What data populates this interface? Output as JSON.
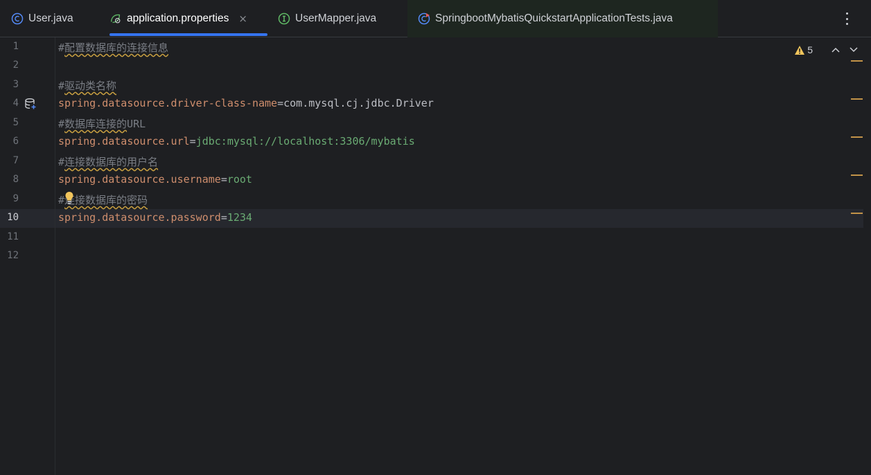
{
  "tabs": [
    {
      "label": "User.java",
      "icon": "class-c-icon",
      "active": false
    },
    {
      "label": "application.properties",
      "icon": "spring-leaf-icon",
      "active": true,
      "close": "×"
    },
    {
      "label": "UserMapper.java",
      "icon": "interface-i-icon",
      "active": false
    },
    {
      "label": "SpringbootMybatisQuickstartApplicationTests.java",
      "icon": "test-class-icon",
      "active": false
    }
  ],
  "inspection": {
    "warnings": "5"
  },
  "lines": [
    {
      "n": "1"
    },
    {
      "n": "2"
    },
    {
      "n": "3"
    },
    {
      "n": "4"
    },
    {
      "n": "5"
    },
    {
      "n": "6"
    },
    {
      "n": "7"
    },
    {
      "n": "8"
    },
    {
      "n": "9"
    },
    {
      "n": "10"
    },
    {
      "n": "11"
    },
    {
      "n": "12"
    }
  ],
  "code": {
    "l1_hash": "#",
    "l1_text": "配置数据库的连接信息",
    "l3_hash": "#",
    "l3_text": "驱动类名称",
    "l4_key": "spring.datasource.driver-class-name",
    "l4_eq": "=",
    "l4_val": "com.mysql.cj.jdbc.Driver",
    "l5_hash": "#",
    "l5_text": "数据库连接的",
    "l5_tail": "URL",
    "l6_key": "spring.datasource.url",
    "l6_eq": "=",
    "l6_val": "jdbc:mysql://localhost:3306/mybatis",
    "l7_hash": "#",
    "l7_text": "连接数据库的用户名",
    "l8_key": "spring.datasource.username",
    "l8_eq": "=",
    "l8_val": "root",
    "l9_hash": "#",
    "l9_text": "连接数据库的密码",
    "l10_key": "spring.datasource.password",
    "l10_eq": "=",
    "l10_val": "1234"
  },
  "colors": {
    "background": "#1e1f22",
    "key": "#cf8e6d",
    "value": "#6aab73",
    "comment": "#7a7e85",
    "active_tab_underline": "#3574f0",
    "warning_marker": "#c29348"
  }
}
